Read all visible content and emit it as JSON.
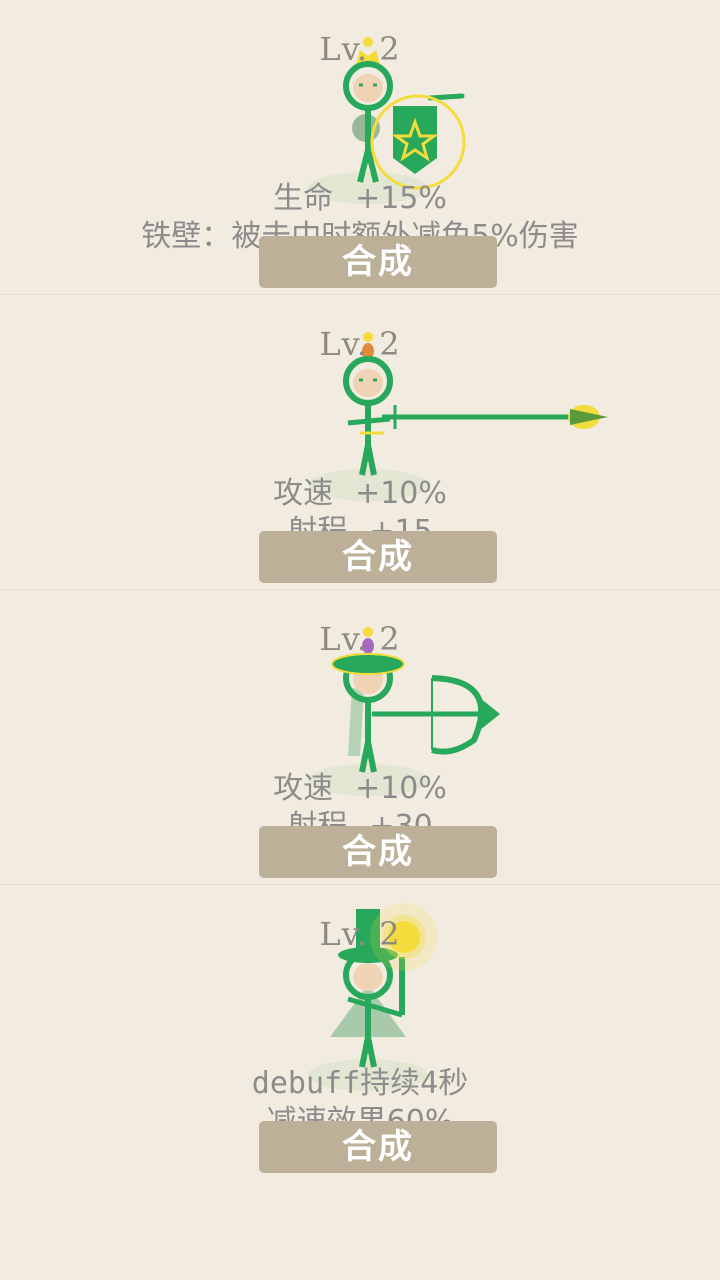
{
  "units": [
    {
      "level": "Lv. 2",
      "stats": [
        {
          "key": "生命",
          "value": "+15%"
        },
        {
          "text": "铁壁：被击中时额外减免5%伤害"
        }
      ],
      "button": "合成",
      "weapon": "shield"
    },
    {
      "level": "Lv. 2",
      "stats": [
        {
          "key": "攻速",
          "value": "+10%"
        },
        {
          "key": "射程",
          "value": "+15"
        }
      ],
      "button": "合成",
      "weapon": "spear"
    },
    {
      "level": "Lv. 2",
      "stats": [
        {
          "key": "攻速",
          "value": "+10%"
        },
        {
          "key": "射程",
          "value": "+30"
        }
      ],
      "button": "合成",
      "weapon": "bow"
    },
    {
      "level": "Lv. 2",
      "stats": [
        {
          "text": "debuff持续4秒"
        },
        {
          "text": "减速效果60%"
        }
      ],
      "button": "合成",
      "weapon": "staff"
    }
  ],
  "colors": {
    "background": "#f2ece0",
    "hero_green": "#27a85a",
    "gold": "#f4dc3c",
    "button": "#bdb099",
    "text": "#8c8c8c"
  }
}
